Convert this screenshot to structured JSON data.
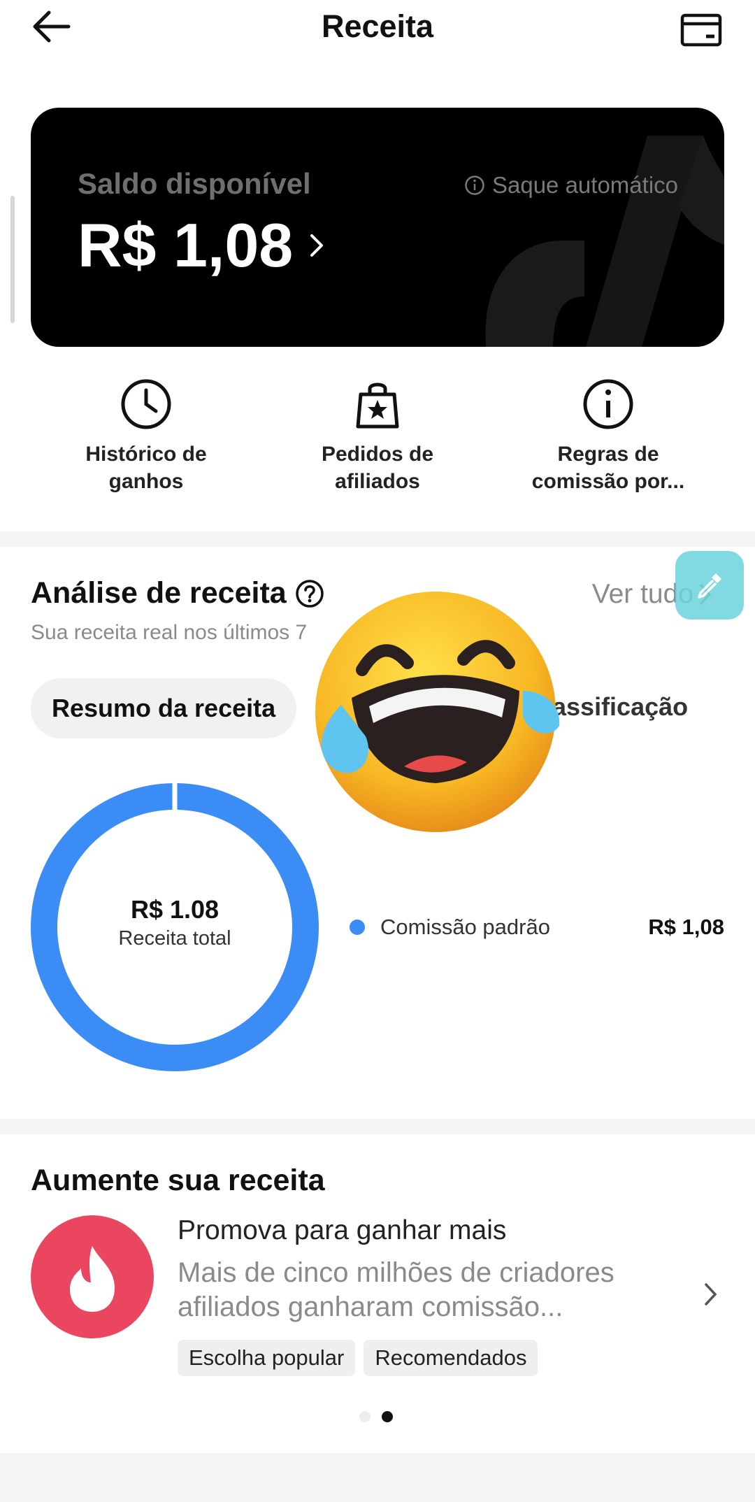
{
  "header": {
    "title": "Receita",
    "back_icon": "arrow-left-icon",
    "wallet_icon": "wallet-icon"
  },
  "balance": {
    "label": "Saldo disponível",
    "amount": "R$ 1,08",
    "auto_withdraw": "Saque automático"
  },
  "shortcuts": [
    {
      "icon": "clock-icon",
      "line1": "Histórico de",
      "line2": "ganhos"
    },
    {
      "icon": "shopping-bag-icon",
      "line1": "Pedidos de",
      "line2": "afiliados"
    },
    {
      "icon": "info-icon",
      "line1": "Regras de",
      "line2": "comissão por..."
    }
  ],
  "analysis": {
    "title": "Análise de receita",
    "subtitle": "Sua receita real nos últimos 7",
    "view_all": "Ver tudo",
    "tabs": {
      "active": "Resumo da receita",
      "other": "assificação"
    },
    "donut": {
      "value": "R$ 1.08",
      "caption": "Receita total"
    },
    "legend": [
      {
        "name": "Comissão padrão",
        "value": "R$ 1,08",
        "color": "#3c8cf5"
      }
    ]
  },
  "chart_data": {
    "type": "pie",
    "categories": [
      "Comissão padrão"
    ],
    "values": [
      1.08
    ],
    "title": "",
    "center_label": "R$ 1.08",
    "center_caption": "Receita total"
  },
  "boost": {
    "title": "Aumente sua receita",
    "promo_title": "Promova para ganhar mais",
    "promo_desc_line1": "Mais de cinco milhões de criadores",
    "promo_desc_line2": "afiliados ganharam comissão...",
    "tags": [
      "Escolha popular",
      "Recomendados"
    ],
    "icon": "flame-icon",
    "accent": "#ea4660"
  },
  "carousel": {
    "count": 2,
    "active_index": 1
  }
}
